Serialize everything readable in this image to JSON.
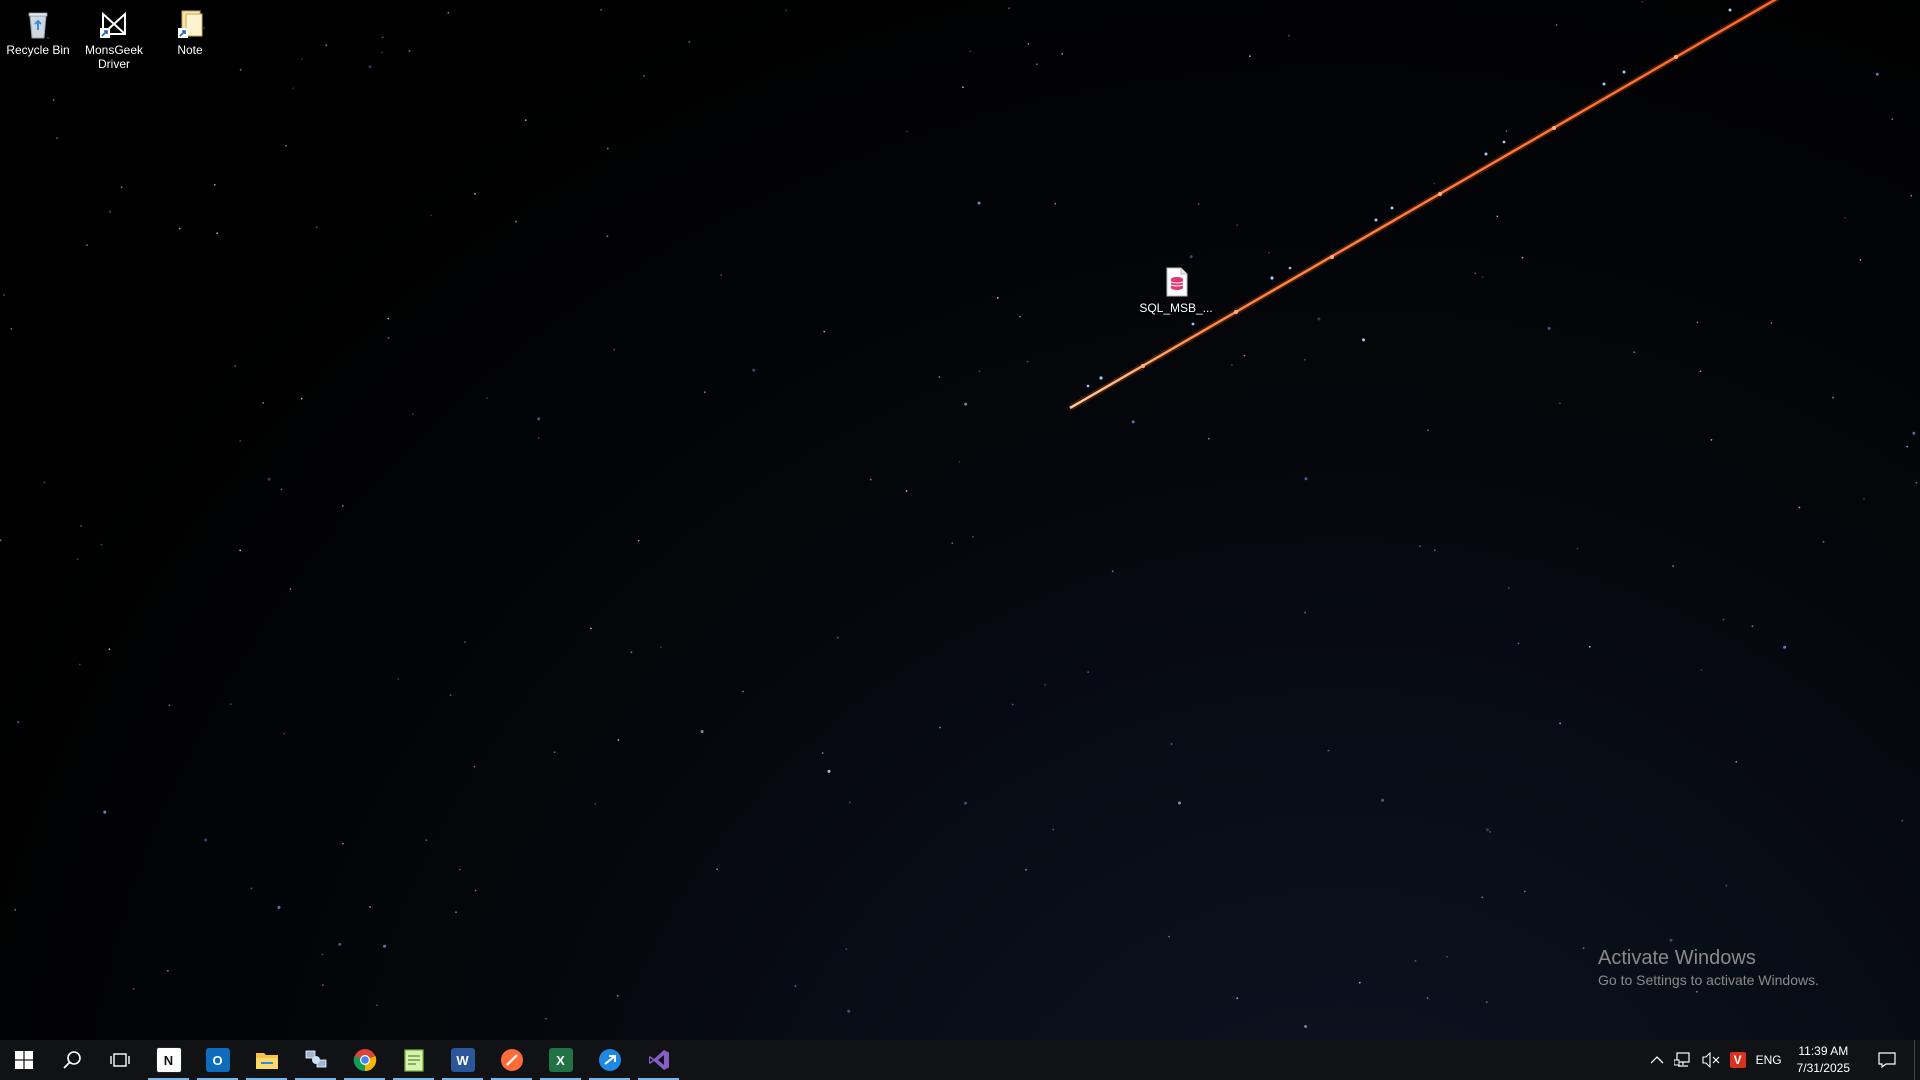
{
  "desktop_icons": [
    {
      "label": "Recycle Bin",
      "icon": "recycle-bin-icon"
    },
    {
      "label": "MonsGeek Driver",
      "icon": "monsgeek-driver-icon"
    },
    {
      "label": "Note",
      "icon": "note-icon"
    },
    {
      "label": "SQL_MSB_...",
      "icon": "sql-file-icon"
    }
  ],
  "watermark": {
    "title": "Activate Windows",
    "subtitle": "Go to Settings to activate Windows."
  },
  "taskbar": {
    "start_icon": "windows-start-icon",
    "search_icon": "search-icon",
    "task_view_icon": "task-view-icon",
    "pinned_apps": [
      {
        "name": "notion-icon",
        "running": true,
        "color": "#ffffff"
      },
      {
        "name": "outlook-icon",
        "running": true,
        "color": "#0f6cbd"
      },
      {
        "name": "file-explorer-icon",
        "running": true,
        "color": "#f3c34a"
      },
      {
        "name": "network-tool-icon",
        "running": true,
        "color": "#9ab6d4"
      },
      {
        "name": "chrome-icon",
        "running": true,
        "color": "#34a853"
      },
      {
        "name": "notepad-plus-icon",
        "running": true,
        "color": "#7cb342"
      },
      {
        "name": "word-icon",
        "running": true,
        "color": "#2b579a"
      },
      {
        "name": "postman-icon",
        "running": true,
        "color": "#ff6c37"
      },
      {
        "name": "excel-icon",
        "running": true,
        "color": "#217346"
      },
      {
        "name": "remote-app-icon",
        "running": true,
        "color": "#1e88e5"
      },
      {
        "name": "visual-studio-icon",
        "running": true,
        "color": "#865fc5"
      }
    ],
    "tray": {
      "language": "ENG",
      "time": "11:39 AM",
      "date": "7/31/2025"
    }
  },
  "colors": {
    "taskbar_bg": "#111216",
    "running_indicator": "#76b9ed",
    "meteor": "#ff7a3a"
  }
}
